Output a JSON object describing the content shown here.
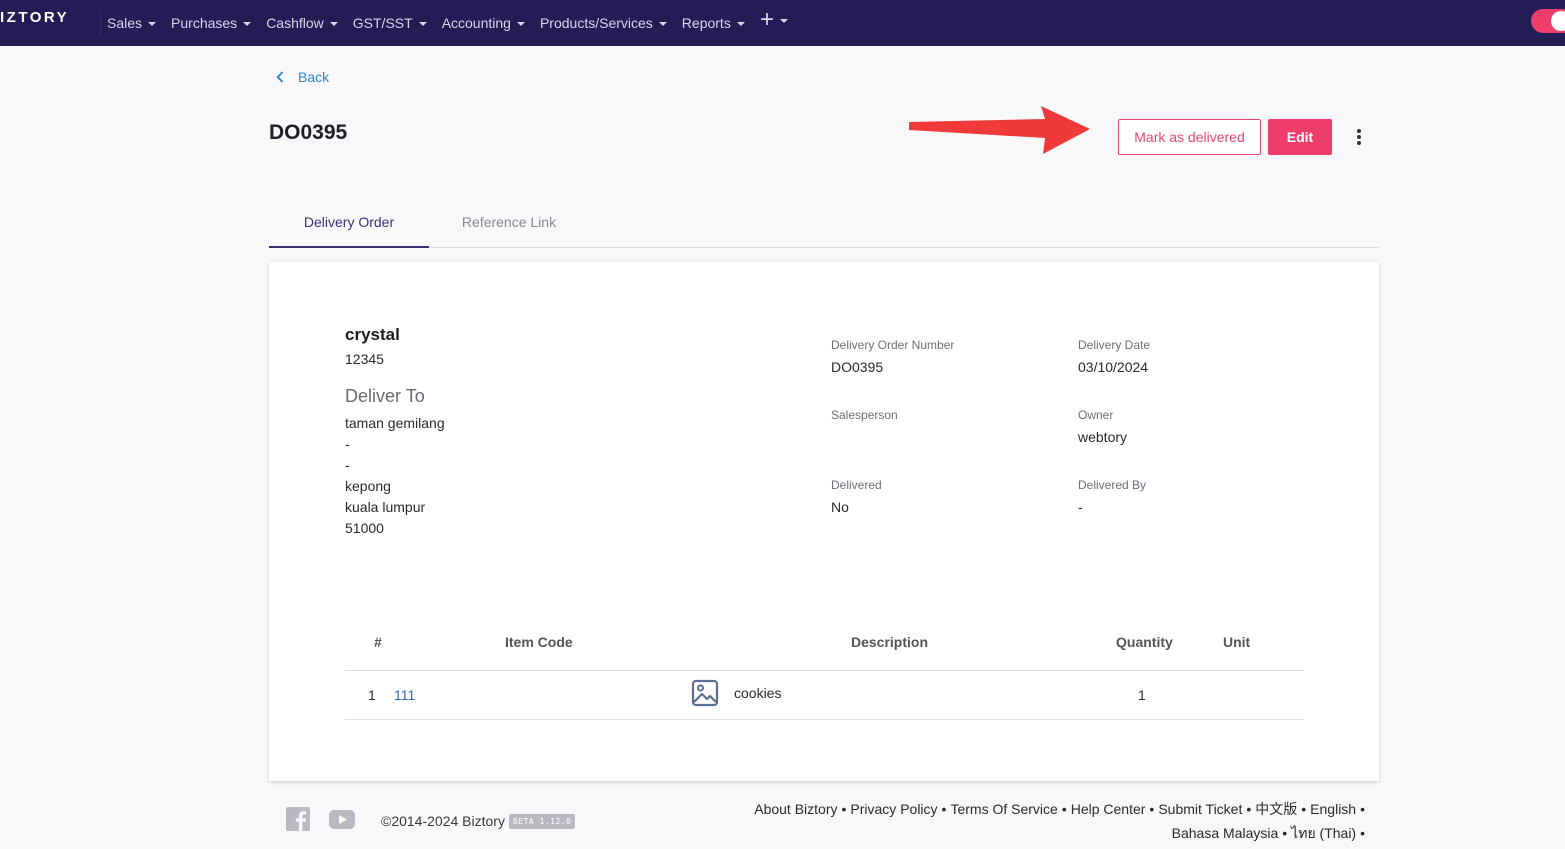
{
  "nav": {
    "brand": "IZTORY",
    "items": [
      {
        "label": "Sales"
      },
      {
        "label": "Purchases"
      },
      {
        "label": "Cashflow"
      },
      {
        "label": "GST/SST"
      },
      {
        "label": "Accounting"
      },
      {
        "label": "Products/Services"
      },
      {
        "label": "Reports"
      }
    ],
    "add_icon": "plus-icon"
  },
  "page": {
    "back_label": "Back",
    "title": "DO0395"
  },
  "actions": {
    "mark_delivered_label": "Mark as delivered",
    "edit_label": "Edit"
  },
  "tabs": [
    {
      "label": "Delivery Order",
      "active": true
    },
    {
      "label": "Reference Link",
      "active": false
    }
  ],
  "customer": {
    "name": "crystal",
    "code": "12345",
    "deliver_to_label": "Deliver To",
    "address_lines": [
      "taman gemilang",
      "-",
      "-",
      "kepong",
      "kuala lumpur",
      "51000"
    ]
  },
  "meta": {
    "do_number_label": "Delivery Order Number",
    "do_number": "DO0395",
    "delivery_date_label": "Delivery Date",
    "delivery_date": "03/10/2024",
    "salesperson_label": "Salesperson",
    "owner_label": "Owner",
    "owner": "webtory",
    "delivered_label": "Delivered",
    "delivered": "No",
    "delivered_by_label": "Delivered By",
    "delivered_by": "-"
  },
  "table": {
    "headers": [
      "#",
      "Item Code",
      "Description",
      "Quantity",
      "Unit"
    ],
    "rows": [
      {
        "no": "1",
        "item_code": "111",
        "description": "cookies",
        "quantity": "1",
        "unit": ""
      }
    ]
  },
  "footer": {
    "copyright": "©2014-2024 Biztory",
    "beta": "BETA 1.12.0",
    "links": [
      "About Biztory",
      "Privacy Policy",
      "Terms Of Service",
      "Help Center",
      "Submit Ticket",
      "中文版",
      "English",
      "Bahasa Malaysia",
      "ไทย (Thai)"
    ]
  },
  "colors": {
    "navbar": "#231c55",
    "accent": "#ec3d6b",
    "tab_active": "#3c2f77",
    "link": "#2f86c9",
    "annotation_arrow": "#f03a3a"
  }
}
